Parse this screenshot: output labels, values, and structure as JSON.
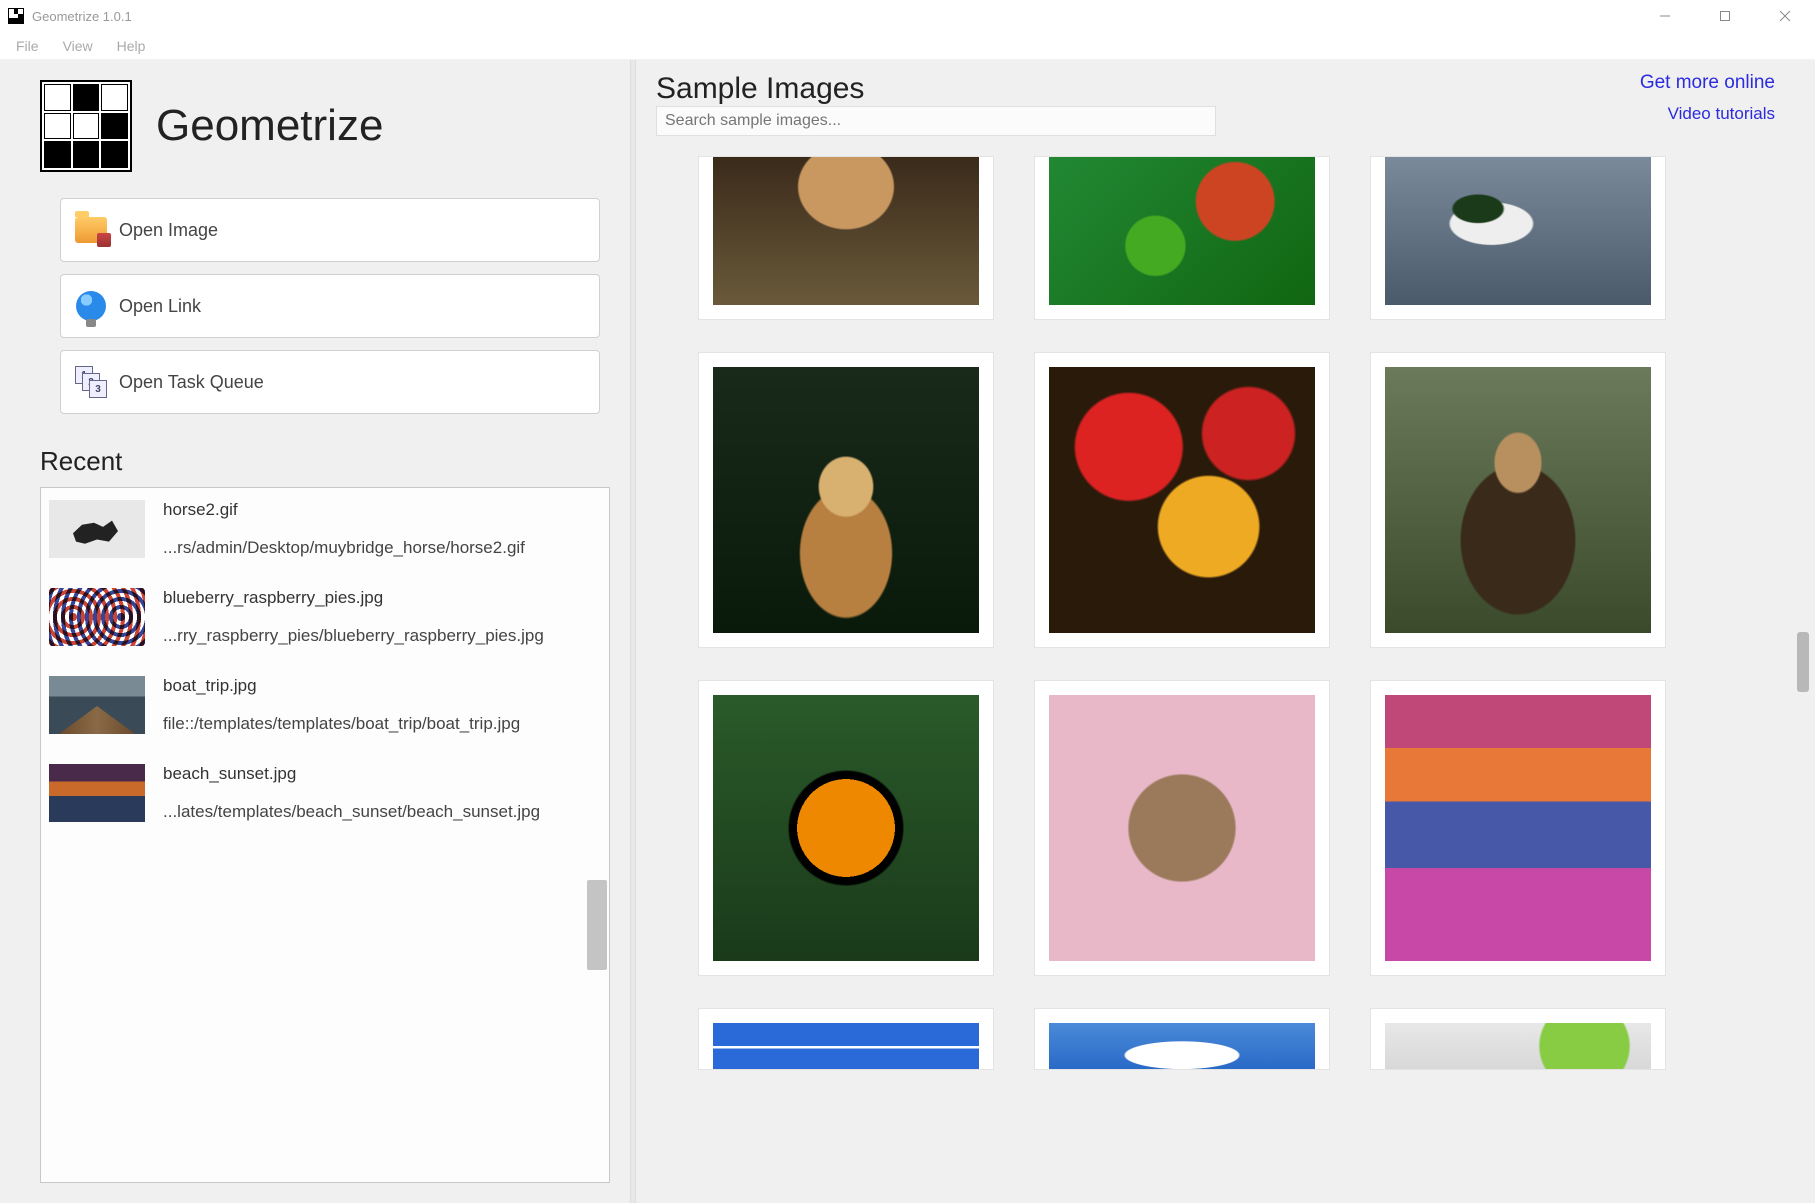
{
  "window": {
    "title": "Geometrize 1.0.1"
  },
  "menu": {
    "file": "File",
    "view": "View",
    "help": "Help"
  },
  "brand": {
    "name": "Geometrize"
  },
  "actions": {
    "open_image": "Open Image",
    "open_link": "Open Link",
    "open_task_queue": "Open Task Queue"
  },
  "recent": {
    "header": "Recent",
    "items": [
      {
        "name": "horse2.gif",
        "path": "...rs/admin/Desktop/muybridge_horse/horse2.gif"
      },
      {
        "name": "blueberry_raspberry_pies.jpg",
        "path": "...rry_raspberry_pies/blueberry_raspberry_pies.jpg"
      },
      {
        "name": "boat_trip.jpg",
        "path": "file::/templates/templates/boat_trip/boat_trip.jpg"
      },
      {
        "name": "beach_sunset.jpg",
        "path": "...lates/templates/beach_sunset/beach_sunset.jpg"
      }
    ]
  },
  "samples": {
    "header": "Sample Images",
    "search_placeholder": "Search sample images...",
    "get_more": "Get more online",
    "tutorials": "Video tutorials"
  }
}
